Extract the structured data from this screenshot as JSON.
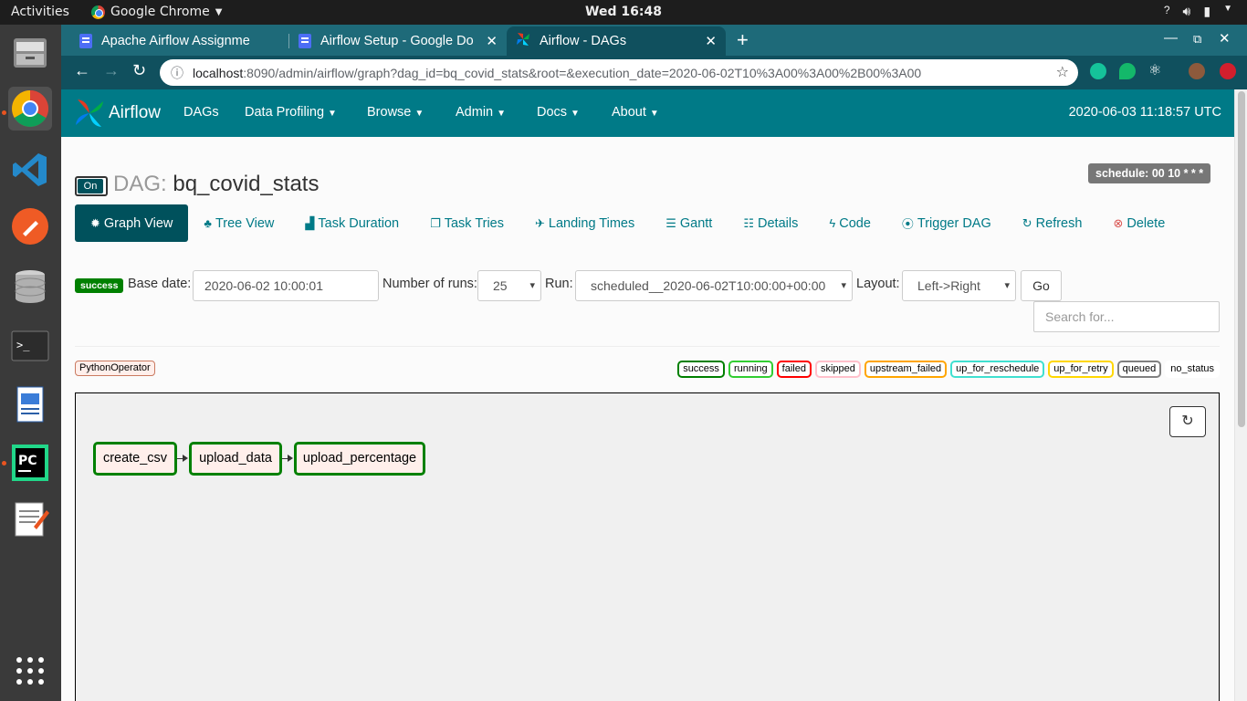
{
  "system": {
    "activities": "Activities",
    "app_name": "Google Chrome",
    "clock": "Wed 16:48"
  },
  "browser": {
    "tabs": [
      {
        "title": "Apache Airflow Assignme"
      },
      {
        "title": "Airflow Setup - Google Do"
      },
      {
        "title": "Airflow - DAGs"
      }
    ],
    "url_host": "localhost",
    "url_rest": ":8090/admin/airflow/graph?dag_id=bq_covid_stats&root=&execution_date=2020-06-02T10%3A00%3A00%2B00%3A00"
  },
  "airflow": {
    "brand": "Airflow",
    "nav": [
      {
        "label": "DAGs"
      },
      {
        "label": "Data Profiling"
      },
      {
        "label": "Browse"
      },
      {
        "label": "Admin"
      },
      {
        "label": "Docs"
      },
      {
        "label": "About"
      }
    ],
    "utc_time": "2020-06-03 11:18:57 UTC",
    "toggle_label": "On",
    "dag_label": "DAG:",
    "dag_id": "bq_covid_stats",
    "schedule": "schedule: 00 10 * * *",
    "view_tabs": [
      {
        "label": "Graph View",
        "icon": "gear-icon"
      },
      {
        "label": "Tree View",
        "icon": "tree-icon"
      },
      {
        "label": "Task Duration",
        "icon": "bar-chart-icon"
      },
      {
        "label": "Task Tries",
        "icon": "copy-icon"
      },
      {
        "label": "Landing Times",
        "icon": "plane-icon"
      },
      {
        "label": "Gantt",
        "icon": "align-left-icon"
      },
      {
        "label": "Details",
        "icon": "list-icon"
      },
      {
        "label": "Code",
        "icon": "flash-icon"
      },
      {
        "label": "Trigger DAG",
        "icon": "play-circle-icon"
      },
      {
        "label": "Refresh",
        "icon": "refresh-icon"
      },
      {
        "label": "Delete",
        "icon": "remove-circle-icon"
      }
    ],
    "form": {
      "state_badge": "success",
      "base_date_label": "Base date:",
      "base_date_value": "2020-06-02 10:00:01",
      "num_runs_label": "Number of runs:",
      "num_runs_value": "25",
      "run_label": "Run:",
      "run_value": "scheduled__2020-06-02T10:00:00+00:00",
      "layout_label": "Layout:",
      "layout_value": "Left->Right",
      "go_label": "Go",
      "search_placeholder": "Search for..."
    },
    "operator_tag": "PythonOperator",
    "legend": [
      {
        "label": "success",
        "color": "#008000"
      },
      {
        "label": "running",
        "color": "#32cd32"
      },
      {
        "label": "failed",
        "color": "#ff0000"
      },
      {
        "label": "skipped",
        "color": "#ffc0cb"
      },
      {
        "label": "upstream_failed",
        "color": "#ffa500"
      },
      {
        "label": "up_for_reschedule",
        "color": "#40e0d0"
      },
      {
        "label": "up_for_retry",
        "color": "#ffd700"
      },
      {
        "label": "queued",
        "color": "#808080"
      },
      {
        "label": "no_status",
        "color": "none"
      }
    ],
    "tasks": [
      {
        "id": "create_csv",
        "state": "success"
      },
      {
        "id": "upload_data",
        "state": "success"
      },
      {
        "id": "upload_percentage",
        "state": "success"
      }
    ]
  }
}
